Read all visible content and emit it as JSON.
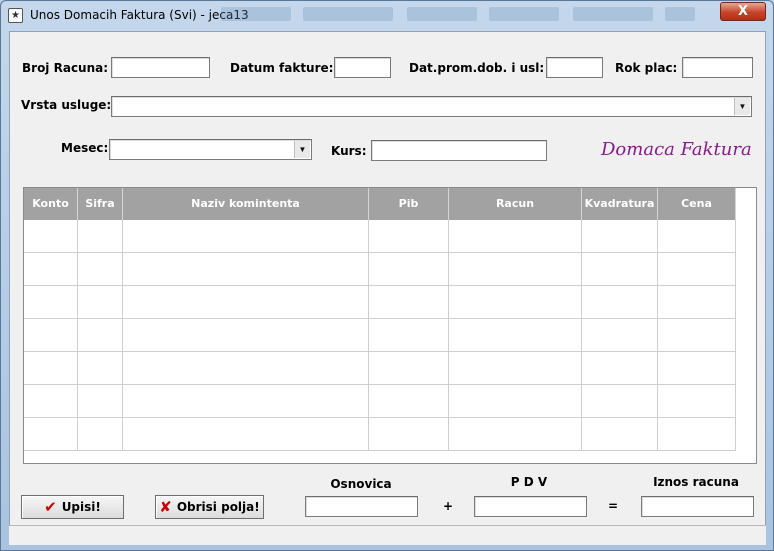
{
  "window": {
    "title": "Unos Domacih Faktura (Svi) - jeca13",
    "close_label": "X"
  },
  "form": {
    "broj_racuna_label": "Broj Racuna:",
    "broj_racuna_value": "",
    "datum_fakture_label": "Datum fakture:",
    "datum_fakture_value": "",
    "dat_prom_label": "Dat.prom.dob. i usl:",
    "dat_prom_value": "",
    "rok_plac_label": "Rok plac:",
    "rok_plac_value": "",
    "vrsta_usluge_label": "Vrsta usluge:",
    "vrsta_usluge_value": "",
    "mesec_label": "Mesec:",
    "mesec_value": "",
    "kurs_label": "Kurs:",
    "kurs_value": "",
    "brand_text": "Domaca Faktura"
  },
  "grid": {
    "columns": [
      "Konto",
      "Sifra",
      "Naziv komintenta",
      "Pib",
      "Racun",
      "Kvadratura",
      "Cena"
    ],
    "rows": [
      [
        "",
        "",
        "",
        "",
        "",
        "",
        ""
      ],
      [
        "",
        "",
        "",
        "",
        "",
        "",
        ""
      ],
      [
        "",
        "",
        "",
        "",
        "",
        "",
        ""
      ],
      [
        "",
        "",
        "",
        "",
        "",
        "",
        ""
      ],
      [
        "",
        "",
        "",
        "",
        "",
        "",
        ""
      ],
      [
        "",
        "",
        "",
        "",
        "",
        "",
        ""
      ],
      [
        "",
        "",
        "",
        "",
        "",
        "",
        ""
      ]
    ]
  },
  "footer": {
    "upisi_label": "Upisi!",
    "obrisi_label": "Obrisi polja!",
    "osnovica_label": "Osnovica",
    "osnovica_value": "",
    "pdv_label": "P D V",
    "pdv_value": "",
    "iznos_label": "Iznos racuna",
    "iznos_value": "",
    "plus_sign": "+",
    "equals_sign": "="
  },
  "colors": {
    "brand": "#8a1a8a",
    "grid_header": "#a2a2a2",
    "upisi_icon": "#cc0000",
    "obrisi_icon": "#cc0000"
  },
  "icons": {
    "app": "app-icon",
    "combo_arrow": "chevron-down-icon",
    "upisi": "checkmark-icon",
    "obrisi": "x-delete-icon"
  }
}
